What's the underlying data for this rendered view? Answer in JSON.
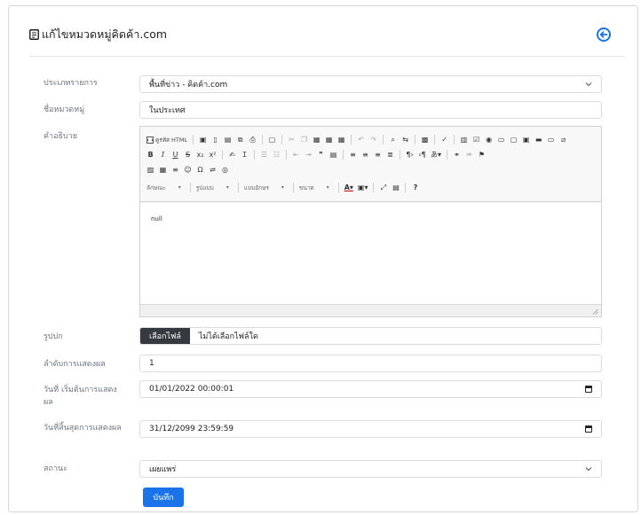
{
  "header": {
    "title": "แก้ไขหมวดหมู่คิดค้า.com"
  },
  "form": {
    "news_type": {
      "label": "ประเภทรายการ",
      "value": "พื้นที่ข่าว - คิดค้า.com"
    },
    "category_name": {
      "label": "ชื่อหมวดหมู่",
      "value": "ในประเทศ"
    },
    "description": {
      "label": "คำอธิบาย",
      "content": "null"
    },
    "cover_image": {
      "label": "รูปปก",
      "button_label": "เลือกไฟล์",
      "file_status": "ไม่ได้เลือกไฟล์ใด"
    },
    "display_order": {
      "label": "ลำดับการแสดงผล",
      "value": "1"
    },
    "start_date": {
      "label": "วันที่ เริ่มต้นการแสดงผล",
      "value": "01/01/2022 00:00:01"
    },
    "end_date": {
      "label": "วันที่สิ้นสุดการแสดงผล",
      "value": "31/12/2099 23:59:59"
    },
    "status": {
      "label": "สถานะ",
      "value": "เผยแพร่"
    },
    "save_label": "บันทึก"
  },
  "editor_toolbar": {
    "source_label": "ดูรหัส HTML",
    "format_combos": [
      "ลักษณะ",
      "รูปแบบ",
      "แบบอักษร",
      "ขนาด"
    ],
    "help_label": "?"
  },
  "colors": {
    "accent": "#1a73e8",
    "file_button": "#343a40",
    "label_text": "#6c757d"
  }
}
